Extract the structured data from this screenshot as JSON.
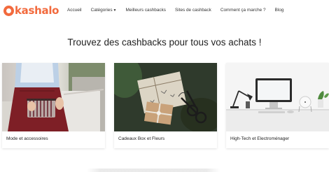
{
  "brand": {
    "name": "kashalo",
    "color": "#f26a3d"
  },
  "nav": {
    "items": [
      {
        "label": "Accueil"
      },
      {
        "label": "Catégories"
      },
      {
        "label": "Meilleurs cashbacks"
      },
      {
        "label": "Sites de cashback"
      },
      {
        "label": "Comment ça marche ?"
      },
      {
        "label": "Blog"
      }
    ],
    "dropdown_icon": "chevron-down-icon"
  },
  "main": {
    "headline": "Trouvez des cashbacks pour tous vos achats !",
    "cards": [
      {
        "label": "Mode et accessoires",
        "image": "fashion-photo"
      },
      {
        "label": "Cadeaux Box et Fleurs",
        "image": "gifts-photo"
      },
      {
        "label": "High-Tech et Electroménager",
        "image": "desk-photo"
      }
    ]
  }
}
